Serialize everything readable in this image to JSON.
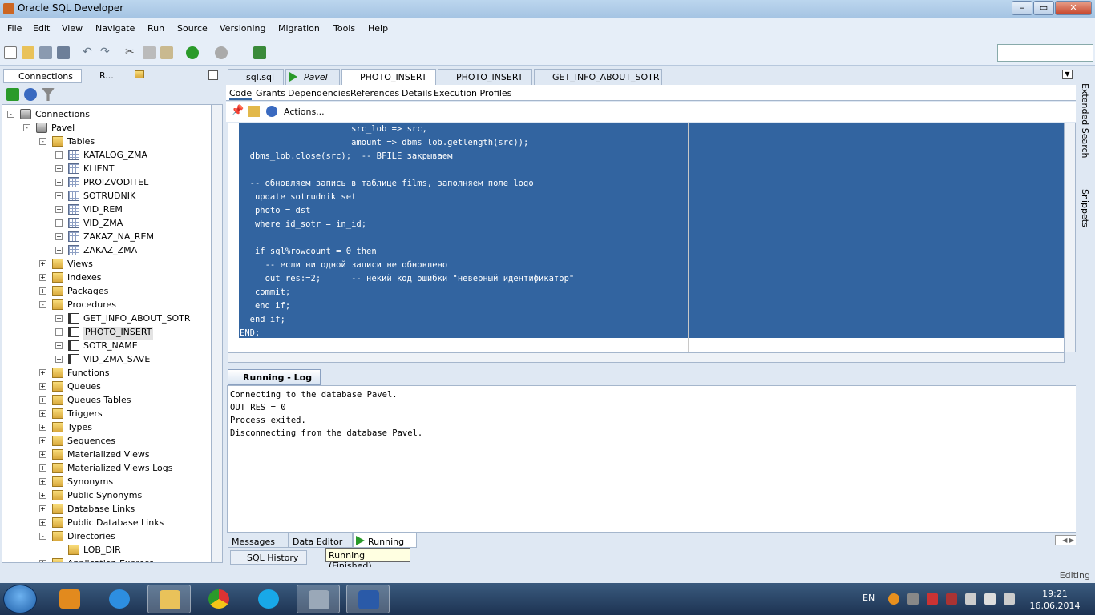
{
  "window": {
    "title": "Oracle SQL Developer"
  },
  "menu": [
    "File",
    "Edit",
    "View",
    "Navigate",
    "Run",
    "Source",
    "Versioning",
    "Migration",
    "Tools",
    "Help"
  ],
  "left_tabs": {
    "connections": "Connections",
    "reports": "R..."
  },
  "tree": [
    {
      "label": "Connections",
      "level": 0,
      "icon": "db",
      "exp": "-"
    },
    {
      "label": "Pavel",
      "level": 1,
      "icon": "db",
      "exp": "-"
    },
    {
      "label": "Tables",
      "level": 2,
      "icon": "folder",
      "exp": "-"
    },
    {
      "label": "KATALOG_ZMA",
      "level": 3,
      "icon": "table",
      "exp": "+"
    },
    {
      "label": "KLIENT",
      "level": 3,
      "icon": "table",
      "exp": "+"
    },
    {
      "label": "PROIZVODITEL",
      "level": 3,
      "icon": "table",
      "exp": "+"
    },
    {
      "label": "SOTRUDNIK",
      "level": 3,
      "icon": "table",
      "exp": "+"
    },
    {
      "label": "VID_REM",
      "level": 3,
      "icon": "table",
      "exp": "+"
    },
    {
      "label": "VID_ZMA",
      "level": 3,
      "icon": "table",
      "exp": "+"
    },
    {
      "label": "ZAKAZ_NA_REM",
      "level": 3,
      "icon": "table",
      "exp": "+"
    },
    {
      "label": "ZAKAZ_ZMA",
      "level": 3,
      "icon": "table",
      "exp": "+"
    },
    {
      "label": "Views",
      "level": 2,
      "icon": "folder",
      "exp": "+"
    },
    {
      "label": "Indexes",
      "level": 2,
      "icon": "folder",
      "exp": "+"
    },
    {
      "label": "Packages",
      "level": 2,
      "icon": "folder",
      "exp": "+"
    },
    {
      "label": "Procedures",
      "level": 2,
      "icon": "folder",
      "exp": "-"
    },
    {
      "label": "GET_INFO_ABOUT_SOTR",
      "level": 3,
      "icon": "proc",
      "exp": "+"
    },
    {
      "label": "PHOTO_INSERT",
      "level": 3,
      "icon": "proc",
      "exp": "+",
      "selected": true
    },
    {
      "label": "SOTR_NAME",
      "level": 3,
      "icon": "proc",
      "exp": "+"
    },
    {
      "label": "VID_ZMA_SAVE",
      "level": 3,
      "icon": "proc",
      "exp": "+"
    },
    {
      "label": "Functions",
      "level": 2,
      "icon": "folder",
      "exp": "+"
    },
    {
      "label": "Queues",
      "level": 2,
      "icon": "folder",
      "exp": "+"
    },
    {
      "label": "Queues Tables",
      "level": 2,
      "icon": "folder",
      "exp": "+"
    },
    {
      "label": "Triggers",
      "level": 2,
      "icon": "folder",
      "exp": "+"
    },
    {
      "label": "Types",
      "level": 2,
      "icon": "folder",
      "exp": "+"
    },
    {
      "label": "Sequences",
      "level": 2,
      "icon": "folder",
      "exp": "+"
    },
    {
      "label": "Materialized Views",
      "level": 2,
      "icon": "folder",
      "exp": "+"
    },
    {
      "label": "Materialized Views Logs",
      "level": 2,
      "icon": "folder",
      "exp": "+"
    },
    {
      "label": "Synonyms",
      "level": 2,
      "icon": "folder",
      "exp": "+"
    },
    {
      "label": "Public Synonyms",
      "level": 2,
      "icon": "folder",
      "exp": "+"
    },
    {
      "label": "Database Links",
      "level": 2,
      "icon": "folder",
      "exp": "+"
    },
    {
      "label": "Public Database Links",
      "level": 2,
      "icon": "folder",
      "exp": "+"
    },
    {
      "label": "Directories",
      "level": 2,
      "icon": "folder",
      "exp": "-"
    },
    {
      "label": "LOB_DIR",
      "level": 3,
      "icon": "folder",
      "exp": ""
    },
    {
      "label": "Application Express",
      "level": 2,
      "icon": "folder",
      "exp": "+"
    }
  ],
  "editor_tabs": [
    {
      "label": "sql.sql",
      "active": false
    },
    {
      "label": "Pavel",
      "active": false
    },
    {
      "label": "PHOTO_INSERT",
      "active": true
    },
    {
      "label": "PHOTO_INSERT",
      "active": false
    },
    {
      "label": "GET_INFO_ABOUT_SOTR",
      "active": false
    }
  ],
  "sub_tabs": [
    "Code",
    "Grants",
    "Dependencies",
    "References",
    "Details",
    "Execution Profiles"
  ],
  "actions_label": "Actions...",
  "code_lines": [
    "                      src_lob => src,",
    "                      amount => dbms_lob.getlength(src));",
    "  dbms_lob.close(src);  -- BFILE закрываем",
    "",
    "  -- обновляем запись в таблице films, заполняем поле logo",
    "   update sotrudnik set",
    "   photo = dst",
    "   where id_sotr = in_id;",
    "",
    "   if sql%rowcount = 0 then",
    "     -- если ни одной записи не обновлено",
    "     out_res:=2;      -- некий код ошибки \"неверный идентификатор\"",
    "   commit;",
    "   end if;",
    "  end if;",
    "END;"
  ],
  "log": {
    "title": "Running - Log",
    "lines": [
      "Connecting to the database Pavel.",
      "OUT_RES = 0",
      "Process exited.",
      "Disconnecting from the database Pavel."
    ]
  },
  "bottom_tabs": [
    "Messages",
    "Data Editor",
    "Running"
  ],
  "tooltip": "Running (Finished)",
  "history_tab": "SQL History",
  "right_strip": [
    "Extended Search",
    "Snippets"
  ],
  "status": "Editing",
  "taskbar": {
    "lang": "EN",
    "time": "19:21",
    "date": "16.06.2014"
  }
}
